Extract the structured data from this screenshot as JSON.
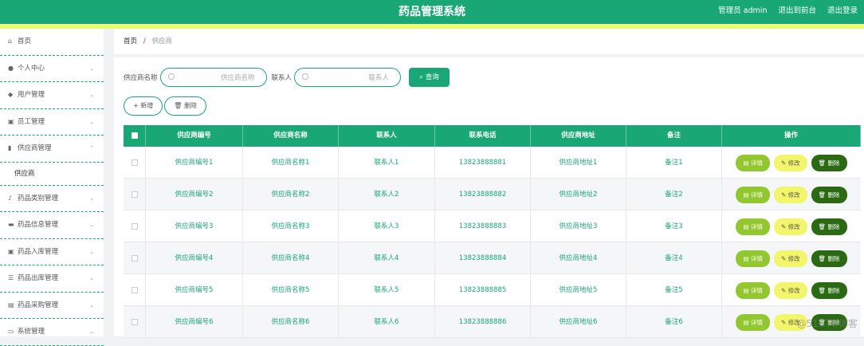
{
  "header": {
    "title": "药品管理系统",
    "user": "管理员 admin",
    "back_link": "退出到前台",
    "logout": "退出登录"
  },
  "sidebar": {
    "items": [
      {
        "icon": "home-icon",
        "glyph": "⌂",
        "label": "首页",
        "chev": ""
      },
      {
        "icon": "user-icon",
        "glyph": "●",
        "label": "个人中心",
        "chev": "⌄"
      },
      {
        "icon": "location-icon",
        "glyph": "◆",
        "label": "用户管理",
        "chev": "⌄"
      },
      {
        "icon": "clipboard-icon",
        "glyph": "▣",
        "label": "员工管理",
        "chev": "⌄"
      },
      {
        "icon": "bar-chart-icon",
        "glyph": "▮",
        "label": "供应商管理",
        "chev": "⌃"
      },
      {
        "icon": "microphone-icon",
        "glyph": "♪",
        "label": "药品类别管理",
        "chev": "⌄"
      },
      {
        "icon": "briefcase-icon",
        "glyph": "▬",
        "label": "药品信息管理",
        "chev": "⌄"
      },
      {
        "icon": "inbox-icon",
        "glyph": "▣",
        "label": "药品入库管理",
        "chev": "⌄"
      },
      {
        "icon": "list-icon",
        "glyph": "☰",
        "label": "药品出库管理",
        "chev": "⌄"
      },
      {
        "icon": "box-icon",
        "glyph": "▤",
        "label": "药品采购管理",
        "chev": "⌄"
      },
      {
        "icon": "monitor-icon",
        "glyph": "▭",
        "label": "系统管理",
        "chev": "⌄"
      }
    ],
    "sub_item": "供应商"
  },
  "breadcrumb": {
    "home": "首页",
    "separator": "/",
    "current": "供应商"
  },
  "search": {
    "supplier_name_label": "供应商名称",
    "supplier_name_placeholder": "供应商名称",
    "contact_label": "联系人",
    "contact_placeholder": "联系人",
    "query_button": "查询"
  },
  "actions": {
    "add": "+ 新增",
    "delete": "删除"
  },
  "table": {
    "columns": [
      "供应商编号",
      "供应商名称",
      "联系人",
      "联系电话",
      "供应商地址",
      "备注",
      "操作"
    ],
    "rows": [
      {
        "code": "供应商编号1",
        "name": "供应商名称1",
        "contact": "联系人1",
        "phone": "13823888881",
        "address": "供应商地址1",
        "note": "备注1"
      },
      {
        "code": "供应商编号2",
        "name": "供应商名称2",
        "contact": "联系人2",
        "phone": "13823888882",
        "address": "供应商地址2",
        "note": "备注2"
      },
      {
        "code": "供应商编号3",
        "name": "供应商名称3",
        "contact": "联系人3",
        "phone": "13823888883",
        "address": "供应商地址3",
        "note": "备注3"
      },
      {
        "code": "供应商编号4",
        "name": "供应商名称4",
        "contact": "联系人4",
        "phone": "13823888884",
        "address": "供应商地址4",
        "note": "备注4"
      },
      {
        "code": "供应商编号5",
        "name": "供应商名称5",
        "contact": "联系人5",
        "phone": "13823888885",
        "address": "供应商地址5",
        "note": "备注5"
      },
      {
        "code": "供应商编号6",
        "name": "供应商名称6",
        "contact": "联系人6",
        "phone": "13823888886",
        "address": "供应商地址6",
        "note": "备注6"
      }
    ],
    "ops": {
      "detail": "详情",
      "edit": "修改",
      "delete": "删除"
    }
  },
  "watermark": "@51CTO博客",
  "colors": {
    "primary": "#1aa776",
    "accent": "#e6ff6b",
    "detail": "#93c72f",
    "edit": "#f3f56b",
    "delete": "#2b6a13"
  }
}
